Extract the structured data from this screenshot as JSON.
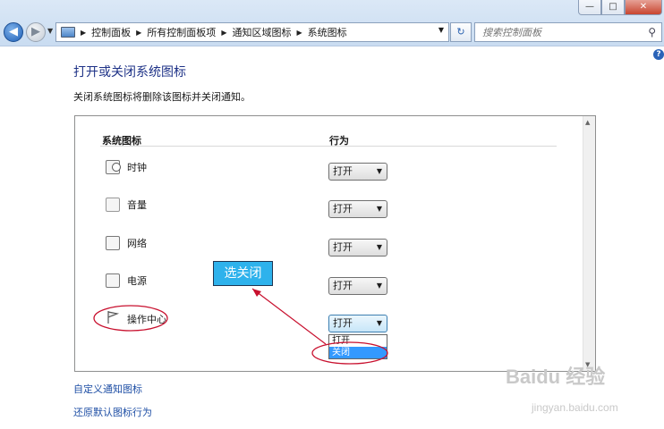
{
  "window": {
    "controls": {
      "minimize": "—",
      "maximize": "□",
      "close": "✕"
    }
  },
  "address_bar": {
    "breadcrumbs": [
      "控制面板",
      "所有控制面板项",
      "通知区域图标",
      "系统图标"
    ]
  },
  "search": {
    "placeholder": "搜索控制面板"
  },
  "page": {
    "title": "打开或关闭系统图标",
    "description": "关闭系统图标将删除该图标并关闭通知。"
  },
  "table": {
    "headers": {
      "icon": "系统图标",
      "behavior": "行为"
    },
    "rows": [
      {
        "label": "时钟",
        "icon": "clock-icon",
        "value": "打开"
      },
      {
        "label": "音量",
        "icon": "volume-icon",
        "value": "打开"
      },
      {
        "label": "网络",
        "icon": "network-icon",
        "value": "打开"
      },
      {
        "label": "电源",
        "icon": "power-icon",
        "value": "打开"
      },
      {
        "label": "操作中心",
        "icon": "flag-icon",
        "value": "打开"
      }
    ]
  },
  "dropdown_options": [
    "打开",
    "关闭"
  ],
  "annotation": {
    "text": "选关闭",
    "color": "#2eb2ec",
    "mark_color": "#c8102e"
  },
  "links": {
    "customize": "自定义通知图标",
    "restore": "还原默认图标行为"
  },
  "watermark": {
    "main": "Baidu 经验",
    "sub": "jingyan.baidu.com"
  }
}
